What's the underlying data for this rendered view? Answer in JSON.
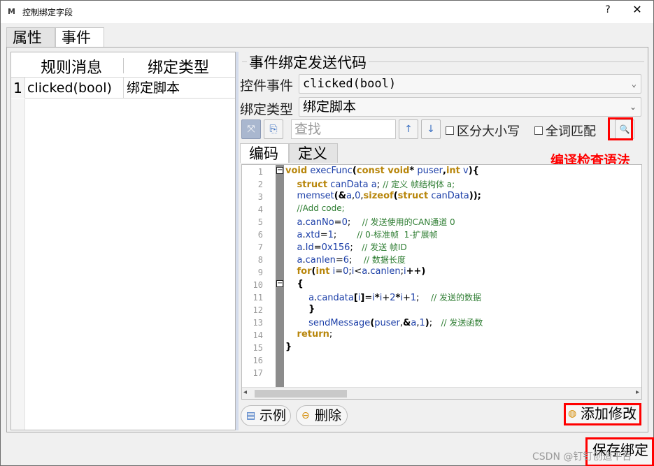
{
  "window": {
    "title_icon": "M",
    "title": "控制绑定字段",
    "help_label": "?",
    "close_label": "✕"
  },
  "main_tabs": [
    {
      "label": "属性"
    },
    {
      "label": "事件"
    }
  ],
  "rule_table": {
    "columns": [
      "规则消息",
      "绑定类型"
    ],
    "rows": [
      {
        "num": "1",
        "message": "clicked(bool)",
        "type": "绑定脚本"
      }
    ]
  },
  "event_group": {
    "title": "事件绑定发送代码",
    "control_event_label": "控件事件",
    "control_event_value": "clicked(bool)",
    "bind_type_label": "绑定类型",
    "bind_type_value": "绑定脚本"
  },
  "toolbar": {
    "expand_icon": "⤧",
    "copy_icon": "⎘",
    "find_placeholder": "查找",
    "up_label": "↑",
    "down_label": "↓",
    "case_label": "区分大小写",
    "whole_word_label": "全词匹配",
    "check_icon": "🔍"
  },
  "annotation": {
    "check_syntax": "编译检查语法"
  },
  "code_tabs": [
    {
      "label": "编码"
    },
    {
      "label": "定义"
    }
  ],
  "editor": {
    "line_numbers": [
      "1",
      "2",
      "3",
      "4",
      "5",
      "6",
      "7",
      "8",
      "9",
      "10",
      "11",
      "12",
      "13",
      "14",
      "15",
      "16",
      "17"
    ]
  },
  "bottom": {
    "example_label": "示例",
    "delete_label": "删除",
    "add_modify_label": "添加修改",
    "save_bind_label": "保存绑定",
    "watermark": "CSDN @钉钉创造平台"
  },
  "colors": {
    "highlight_red": "#ff0000",
    "keyword": "#b8860b",
    "identifier": "#1c3fa8",
    "comment": "#2e7d32"
  }
}
